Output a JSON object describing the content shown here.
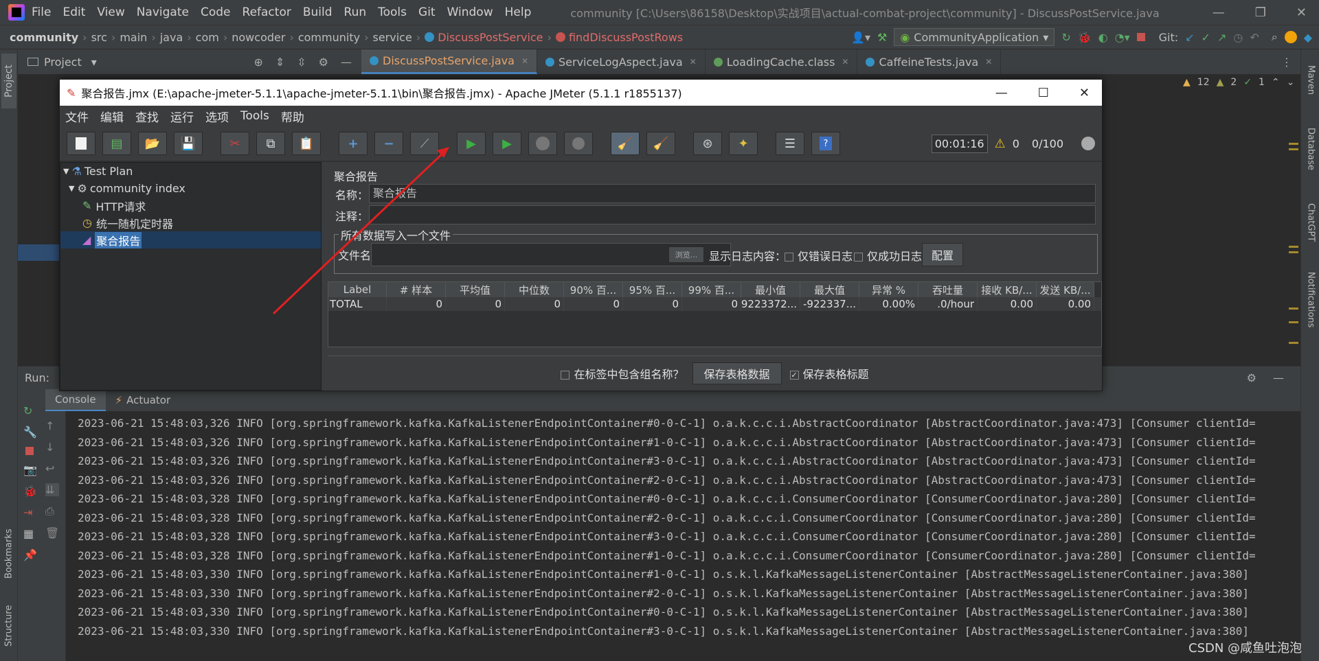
{
  "ide": {
    "menu": [
      "File",
      "Edit",
      "View",
      "Navigate",
      "Code",
      "Refactor",
      "Build",
      "Run",
      "Tools",
      "Git",
      "Window",
      "Help"
    ],
    "title": "community [C:\\Users\\86158\\Desktop\\实战项目\\actual-combat-project\\community] - DiscussPostService.java",
    "breadcrumb": [
      "community",
      "src",
      "main",
      "java",
      "com",
      "nowcoder",
      "community",
      "service",
      "DiscussPostService",
      "findDiscussPostRows"
    ],
    "run_config": "CommunityApplication",
    "git_label": "Git:",
    "project_label": "Project",
    "tabs": [
      "DiscussPostService.java",
      "ServiceLogAspect.java",
      "LoadingCache.class",
      "CaffeineTests.java"
    ],
    "inspections": {
      "warnings": "12",
      "weak": "2",
      "ok": "1"
    },
    "run_label": "Run:",
    "console_tabs": [
      "Console",
      "Actuator"
    ],
    "side_left": [
      "Project",
      "Bookmarks",
      "Structure"
    ],
    "side_right": [
      "Maven",
      "Database",
      "ChatGPT",
      "Notifications"
    ],
    "log_lines": [
      "2023-06-21 15:48:03,326 INFO [org.springframework.kafka.KafkaListenerEndpointContainer#0-0-C-1] o.a.k.c.c.i.AbstractCoordinator [AbstractCoordinator.java:473] [Consumer clientId=",
      "2023-06-21 15:48:03,326 INFO [org.springframework.kafka.KafkaListenerEndpointContainer#1-0-C-1] o.a.k.c.c.i.AbstractCoordinator [AbstractCoordinator.java:473] [Consumer clientId=",
      "2023-06-21 15:48:03,326 INFO [org.springframework.kafka.KafkaListenerEndpointContainer#3-0-C-1] o.a.k.c.c.i.AbstractCoordinator [AbstractCoordinator.java:473] [Consumer clientId=",
      "2023-06-21 15:48:03,326 INFO [org.springframework.kafka.KafkaListenerEndpointContainer#2-0-C-1] o.a.k.c.c.i.AbstractCoordinator [AbstractCoordinator.java:473] [Consumer clientId=",
      "2023-06-21 15:48:03,328 INFO [org.springframework.kafka.KafkaListenerEndpointContainer#0-0-C-1] o.a.k.c.c.i.ConsumerCoordinator [ConsumerCoordinator.java:280] [Consumer clientId=",
      "2023-06-21 15:48:03,328 INFO [org.springframework.kafka.KafkaListenerEndpointContainer#2-0-C-1] o.a.k.c.c.i.ConsumerCoordinator [ConsumerCoordinator.java:280] [Consumer clientId=",
      "2023-06-21 15:48:03,328 INFO [org.springframework.kafka.KafkaListenerEndpointContainer#3-0-C-1] o.a.k.c.c.i.ConsumerCoordinator [ConsumerCoordinator.java:280] [Consumer clientId=",
      "2023-06-21 15:48:03,328 INFO [org.springframework.kafka.KafkaListenerEndpointContainer#1-0-C-1] o.a.k.c.c.i.ConsumerCoordinator [ConsumerCoordinator.java:280] [Consumer clientId=",
      "2023-06-21 15:48:03,330 INFO [org.springframework.kafka.KafkaListenerEndpointContainer#1-0-C-1] o.s.k.l.KafkaMessageListenerContainer [AbstractMessageListenerContainer.java:380]",
      "2023-06-21 15:48:03,330 INFO [org.springframework.kafka.KafkaListenerEndpointContainer#2-0-C-1] o.s.k.l.KafkaMessageListenerContainer [AbstractMessageListenerContainer.java:380]",
      "2023-06-21 15:48:03,330 INFO [org.springframework.kafka.KafkaListenerEndpointContainer#0-0-C-1] o.s.k.l.KafkaMessageListenerContainer [AbstractMessageListenerContainer.java:380]",
      "2023-06-21 15:48:03,330 INFO [org.springframework.kafka.KafkaListenerEndpointContainer#3-0-C-1] o.s.k.l.KafkaMessageListenerContainer [AbstractMessageListenerContainer.java:380]"
    ],
    "watermark": "CSDN @咸鱼吐泡泡"
  },
  "jmeter": {
    "title": "聚合报告.jmx (E:\\apache-jmeter-5.1.1\\apache-jmeter-5.1.1\\bin\\聚合报告.jmx) - Apache JMeter (5.1.1 r1855137)",
    "menu": [
      "文件",
      "编辑",
      "查找",
      "运行",
      "选项",
      "Tools",
      "帮助"
    ],
    "timer": "00:01:16",
    "warn_count": "0",
    "threads": "0/100",
    "tree": [
      {
        "label": "Test Plan",
        "icon": "flask-icon",
        "depth": 0
      },
      {
        "label": "community index",
        "icon": "gear-icon",
        "depth": 1
      },
      {
        "label": "HTTP请求",
        "icon": "pen-icon",
        "depth": 2
      },
      {
        "label": "统一随机定时器",
        "icon": "timer-icon",
        "depth": 2
      },
      {
        "label": "聚合报告",
        "icon": "graph-icon",
        "depth": 2
      }
    ],
    "panel": {
      "heading": "聚合报告",
      "name_label": "名称：",
      "name_value": "聚合报告",
      "comment_label": "注释：",
      "group_title": "所有数据写入一个文件",
      "file_label": "文件名",
      "browse": "浏览...",
      "log_label": "显示日志内容：",
      "errors_only": "仅错误日志",
      "success_only": "仅成功日志",
      "configure": "配置",
      "include_group": "在标签中包含组名称？",
      "save_table": "保存表格数据",
      "save_header": "保存表格标题"
    },
    "columns": [
      "Label",
      "# 样本",
      "平均值",
      "中位数",
      "90% 百...",
      "95% 百...",
      "99% 百...",
      "最小值",
      "最大值",
      "异常 %",
      "吞吐量",
      "接收 KB/...",
      "发送 KB/..."
    ],
    "rows": [
      [
        "TOTAL",
        "0",
        "0",
        "0",
        "0",
        "0",
        "0",
        "9223372...",
        "-922337...",
        "0.00%",
        ".0/hour",
        "0.00",
        "0.00"
      ]
    ]
  },
  "colors": {
    "accent": "#4a88c7",
    "orange": "#e8a46c",
    "arrow": "#e02020"
  }
}
